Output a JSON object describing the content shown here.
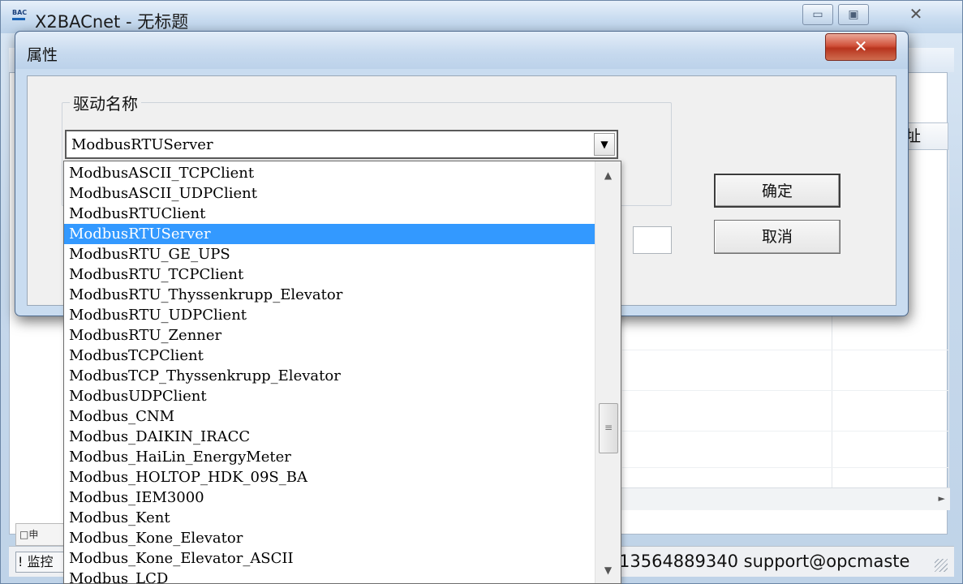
{
  "main_window": {
    "app_icon_text": "BAC",
    "title": "X2BACnet - 无标题",
    "min_glyph": "▭",
    "max_glyph": "▣",
    "close_glyph": "✕",
    "column_header": "址",
    "tab_label": "□申",
    "status_left": "! 监控",
    "status_contact": "13564889340 support@opcmaste"
  },
  "dialog": {
    "title": "属性",
    "close_glyph": "✕",
    "group_label": "驱动名称",
    "combo_value": "ModbusRTUServer",
    "combo_arrow": "▼",
    "ok_label": "确定",
    "cancel_label": "取消"
  },
  "dropdown": {
    "selected_index": 3,
    "scroll_up_glyph": "▲",
    "scroll_down_glyph": "▼",
    "thumb_glyph": "≡",
    "items": [
      "ModbusASCII_TCPClient",
      "ModbusASCII_UDPClient",
      "ModbusRTUClient",
      "ModbusRTUServer",
      "ModbusRTU_GE_UPS",
      "ModbusRTU_TCPClient",
      "ModbusRTU_Thyssenkrupp_Elevator",
      "ModbusRTU_UDPClient",
      "ModbusRTU_Zenner",
      "ModbusTCPClient",
      "ModbusTCP_Thyssenkrupp_Elevator",
      "ModbusUDPClient",
      "Modbus_CNM",
      "Modbus_DAIKIN_IRACC",
      "Modbus_HaiLin_EnergyMeter",
      "Modbus_HOLTOP_HDK_09S_BA",
      "Modbus_IEM3000",
      "Modbus_Kent",
      "Modbus_Kone_Elevator",
      "Modbus_Kone_Elevator_ASCII",
      "Modbus_LCD"
    ]
  }
}
